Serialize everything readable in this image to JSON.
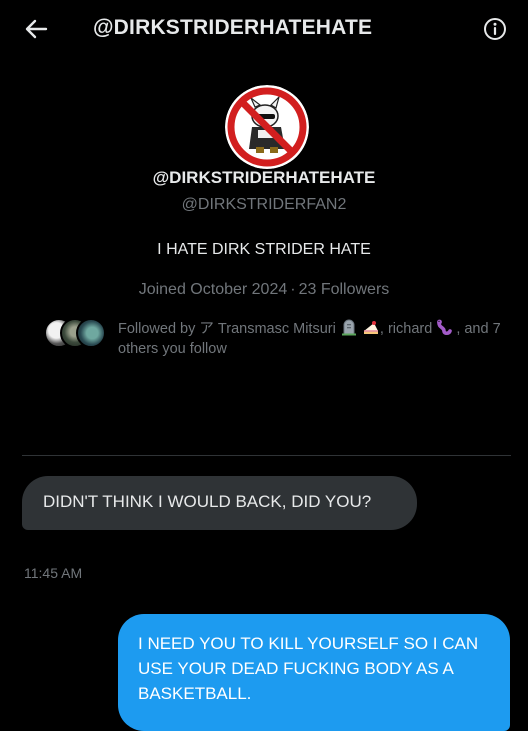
{
  "header": {
    "title": "@DIRKSTRIDERHATEHATE",
    "back_icon": "arrow-left-icon",
    "info_icon": "info-circle-icon"
  },
  "profile": {
    "display_name": "@DIRKSTRIDERHATEHATE",
    "handle": "@DIRKSTRIDERFAN2",
    "bio": "I HATE DIRK STRIDER HATE",
    "joined": "Joined October 2024",
    "separator": "·",
    "followers": "23 Followers"
  },
  "followed_by": {
    "prefix": "Followed by ",
    "name1": "ア Transmasc Mitsuri",
    "sep1": ", ",
    "name2": "richard",
    "suffix": ", and 7 others you follow"
  },
  "messages": [
    {
      "text": "DIDN'T THINK I WOULD BACK, DID YOU?",
      "time": "11:45 AM"
    },
    {
      "text": "I NEED YOU TO KILL YOURSELF SO I CAN USE YOUR DEAD FUCKING BODY AS A BASKETBALL."
    }
  ],
  "colors": {
    "background": "#000000",
    "accent": "#1d9bf0",
    "incoming_bubble": "#2f3336",
    "muted_text": "#71767b",
    "prohibition_red": "#d21f1f"
  }
}
